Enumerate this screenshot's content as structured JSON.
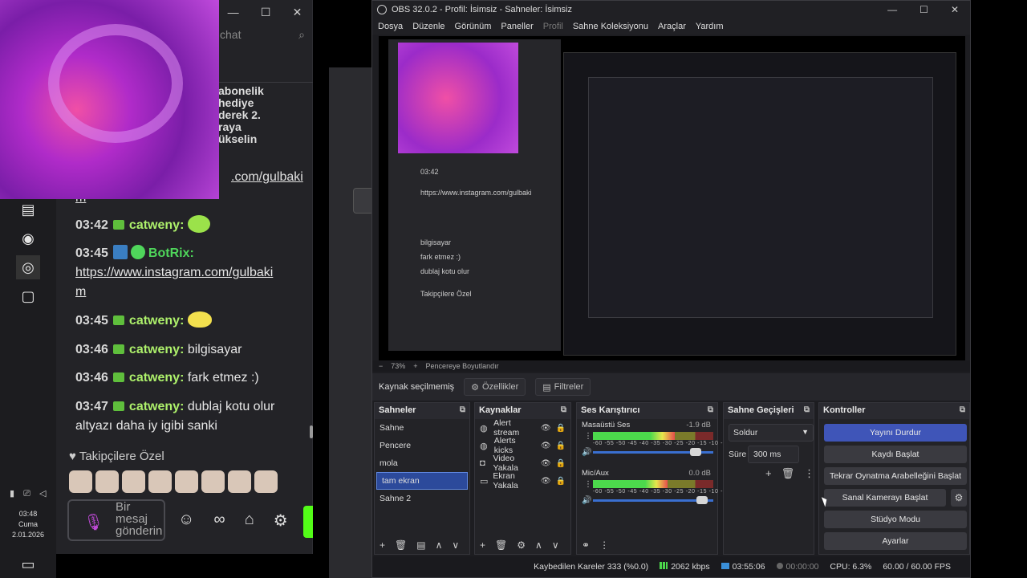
{
  "taskbar": {
    "clock_time": "03:48",
    "clock_day": "Cuma",
    "clock_date": "2.01.2026"
  },
  "chat": {
    "search_placeholder": "chat",
    "announcement_lines": [
      "abonelik",
      "hediye",
      "derek 2.",
      "raya",
      "ükselin"
    ],
    "url_partial": ".com/gulbaki",
    "url_tail": "m",
    "messages": [
      {
        "time": "03:42",
        "user": "catweny:",
        "text": ""
      },
      {
        "time": "03:45",
        "user": "BotRix:",
        "text": "",
        "link": "https://www.instagram.com/gulbaki",
        "link_tail": "m"
      },
      {
        "time": "03:45",
        "user": "catweny:",
        "text": ""
      },
      {
        "time": "03:46",
        "user": "catweny:",
        "text": "bilgisayar"
      },
      {
        "time": "03:46",
        "user": "catweny:",
        "text": "fark etmez :)"
      },
      {
        "time": "03:47",
        "user": "catweny:",
        "text": "dublaj kotu olur",
        "text2": "altyazı daha iy igibi sanki"
      }
    ],
    "followers_label": "Takipçilere Özel",
    "input_placeholder": "Bir mesaj gönderin"
  },
  "obs": {
    "title": "OBS 32.0.2 - Profil: İsimsiz - Sahneler: İsimsiz",
    "menu": [
      "Dosya",
      "Düzenle",
      "Görünüm",
      "Paneller",
      "Profil",
      "Sahne Koleksiyonu",
      "Araçlar",
      "Yardım"
    ],
    "zoom_level": "73%",
    "zoom_mode": "Pencereye Boyutlandır",
    "source_status": "Kaynak seçilmemiş",
    "properties_label": "Özellikler",
    "filters_label": "Filtreler",
    "scenes": {
      "title": "Sahneler",
      "items": [
        "Sahne",
        "Pencere",
        "mola",
        "tam ekran",
        "Sahne 2"
      ],
      "selected": "tam ekran"
    },
    "sources": {
      "title": "Kaynaklar",
      "items": [
        {
          "label": "Alert stream",
          "icon": "globe-icon"
        },
        {
          "label": "Alerts kicks",
          "icon": "globe-icon"
        },
        {
          "label": "Video Yakala",
          "icon": "camera-icon"
        },
        {
          "label": "Ekran Yakala",
          "icon": "monitor-icon"
        }
      ]
    },
    "mixer": {
      "title": "Ses Karıştırıcı",
      "channels": [
        {
          "name": "Masaüstü Ses",
          "db": "-1.9 dB",
          "level": 0.68,
          "fader": 0.9
        },
        {
          "name": "Mic/Aux",
          "db": "0.0 dB",
          "level": 0.62,
          "fader": 0.95
        }
      ],
      "scale": "-60 -55 -50 -45 -40 -35 -30 -25 -20 -15 -10 -5 0"
    },
    "transitions": {
      "title": "Sahne Geçişleri",
      "selected": "Soldur",
      "duration_label": "Süre",
      "duration": "300 ms"
    },
    "controls": {
      "title": "Kontroller",
      "stop_stream": "Yayını Durdur",
      "start_recording": "Kaydı Başlat",
      "start_replay": "Tekrar Oynatma Arabelleğini Başlat",
      "start_vcam": "Sanal Kamerayı Başlat",
      "studio_mode": "Stüdyo Modu",
      "settings": "Ayarlar"
    },
    "status": {
      "dropped": "Kaybedilen Kareler 333 (%0.0)",
      "bitrate": "2062 kbps",
      "stream_time": "03:55:06",
      "rec_time": "00:00:00",
      "cpu": "CPU: 6.3%",
      "fps": "60.00 / 60.00 FPS"
    }
  },
  "colors": {
    "accent": "#3f55b8",
    "selection": "#2c4a9b",
    "kick_green": "#53fc18"
  }
}
